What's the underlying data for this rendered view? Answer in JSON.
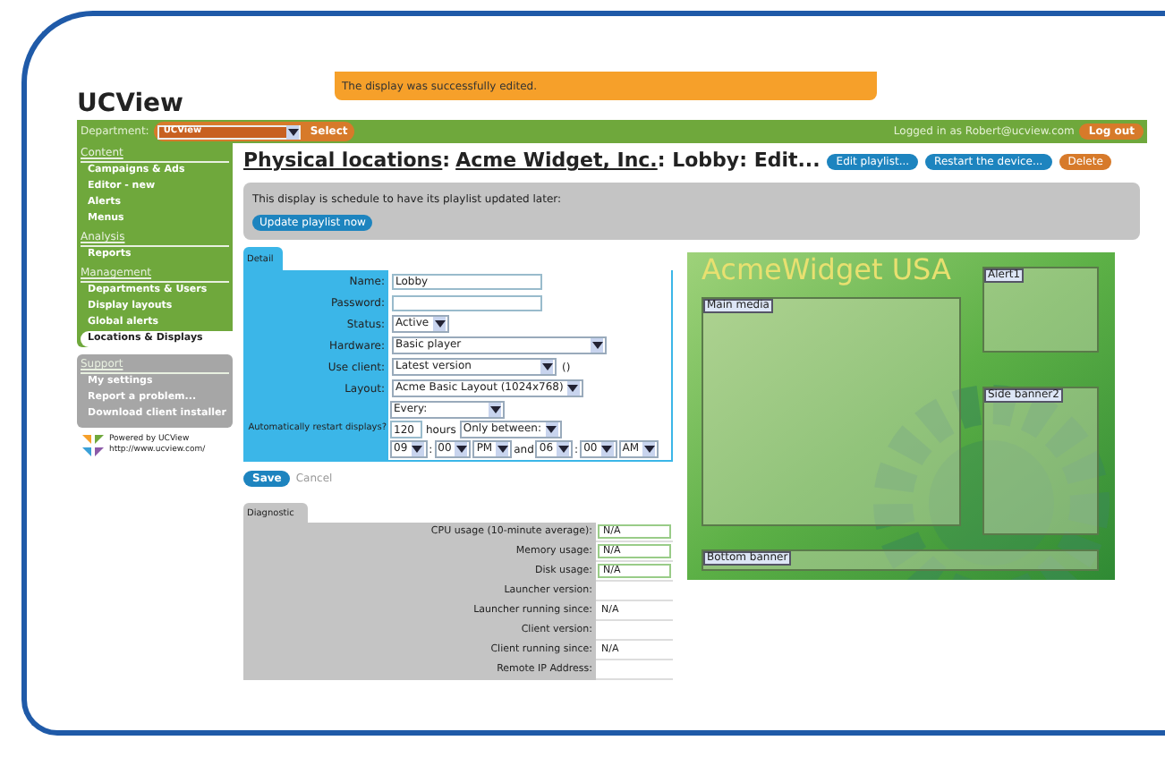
{
  "app": {
    "title": "UCView"
  },
  "notification": "The display was successfully edited.",
  "topbar": {
    "department_label": "Department:",
    "department_value": "UCView",
    "select_button": "Select",
    "logged_in": "Logged in as Robert@ucview.com",
    "logout": "Log out"
  },
  "sidebar": {
    "sections": [
      {
        "heading": "Content",
        "kind": "green",
        "items": [
          {
            "label": "Campaigns & Ads",
            "selected": false
          },
          {
            "label": "Editor - new",
            "selected": false
          },
          {
            "label": "Alerts",
            "selected": false
          },
          {
            "label": "Menus",
            "selected": false
          }
        ]
      },
      {
        "heading": "Analysis",
        "kind": "green",
        "items": [
          {
            "label": "Reports",
            "selected": false
          }
        ]
      },
      {
        "heading": "Management",
        "kind": "green",
        "items": [
          {
            "label": "Departments & Users",
            "selected": false
          },
          {
            "label": "Display layouts",
            "selected": false
          },
          {
            "label": "Global alerts",
            "selected": false
          },
          {
            "label": "Locations & Displays",
            "selected": true
          }
        ]
      },
      {
        "heading": "Support",
        "kind": "grey",
        "items": [
          {
            "label": "My settings",
            "selected": false
          },
          {
            "label": "Report a problem...",
            "selected": false
          },
          {
            "label": "Download client installer",
            "selected": false
          }
        ]
      }
    ]
  },
  "powered": {
    "name": "Powered by UCView",
    "url": "http://www.ucview.com/"
  },
  "page": {
    "title_link_1": "Physical locations",
    "separator": ":",
    "title_link_2": "Acme Widget, Inc.",
    "title_rest": ": Lobby: Edit...",
    "actions": [
      {
        "label": "Edit playlist...",
        "kind": "blue"
      },
      {
        "label": "Restart the device...",
        "kind": "blue"
      },
      {
        "label": "Delete",
        "kind": "orange"
      }
    ]
  },
  "notice": {
    "text": "This display is schedule to have its playlist updated later:",
    "button": "Update playlist now"
  },
  "detail": {
    "tab": "Detail",
    "fields": [
      {
        "label": "Name:",
        "kind": "text",
        "value": "Lobby"
      },
      {
        "label": "Password:",
        "kind": "text"
      },
      {
        "label": "Status:",
        "kind": "short_select",
        "value": "Active"
      },
      {
        "label": "Hardware:",
        "kind": "long_select",
        "value": "Basic player"
      },
      {
        "label": "Use client:",
        "kind": "select",
        "value": "Latest version",
        "suffix": "()"
      },
      {
        "label": "Layout:",
        "kind": "select",
        "value": "Acme Basic Layout (1024x768)"
      }
    ],
    "restart": {
      "label": "Automatically restart displays?",
      "frequency": "Every:",
      "hours_value": "120",
      "hours_label": "hours",
      "range": "Only between:",
      "from_hour": "09",
      "colon_1": ":",
      "from_minute": "00",
      "from_ampm": "PM",
      "and": "and",
      "to_hour": "06",
      "colon_2": ":",
      "to_minute": "00",
      "to_ampm": "AM"
    }
  },
  "save": "Save",
  "cancel": "Cancel",
  "diagnostic": {
    "tab": "Diagnostic",
    "rows": [
      {
        "label": "CPU usage (10-minute average):",
        "value": "N/A",
        "kind": "meter"
      },
      {
        "label": "Memory usage:",
        "value": "N/A",
        "kind": "meter"
      },
      {
        "label": "Disk usage:",
        "value": "N/A",
        "kind": "meter"
      },
      {
        "label": "Launcher version:",
        "kind": "plain"
      },
      {
        "label": "Launcher running since:",
        "value": "N/A",
        "kind": "plain"
      },
      {
        "label": "Client version:",
        "kind": "plain"
      },
      {
        "label": "Client running since:",
        "value": "N/A",
        "kind": "plain"
      },
      {
        "label": "Remote IP Address:",
        "kind": "plain"
      }
    ]
  },
  "preview": {
    "title": "AcmeWidget USA",
    "zones": [
      {
        "label": "Main media",
        "kind": "main"
      },
      {
        "label": "Alert1",
        "kind": "side_top"
      },
      {
        "label": "Side banner2",
        "kind": "side_bottom"
      },
      {
        "label": "Bottom banner",
        "kind": "bottom"
      }
    ]
  }
}
